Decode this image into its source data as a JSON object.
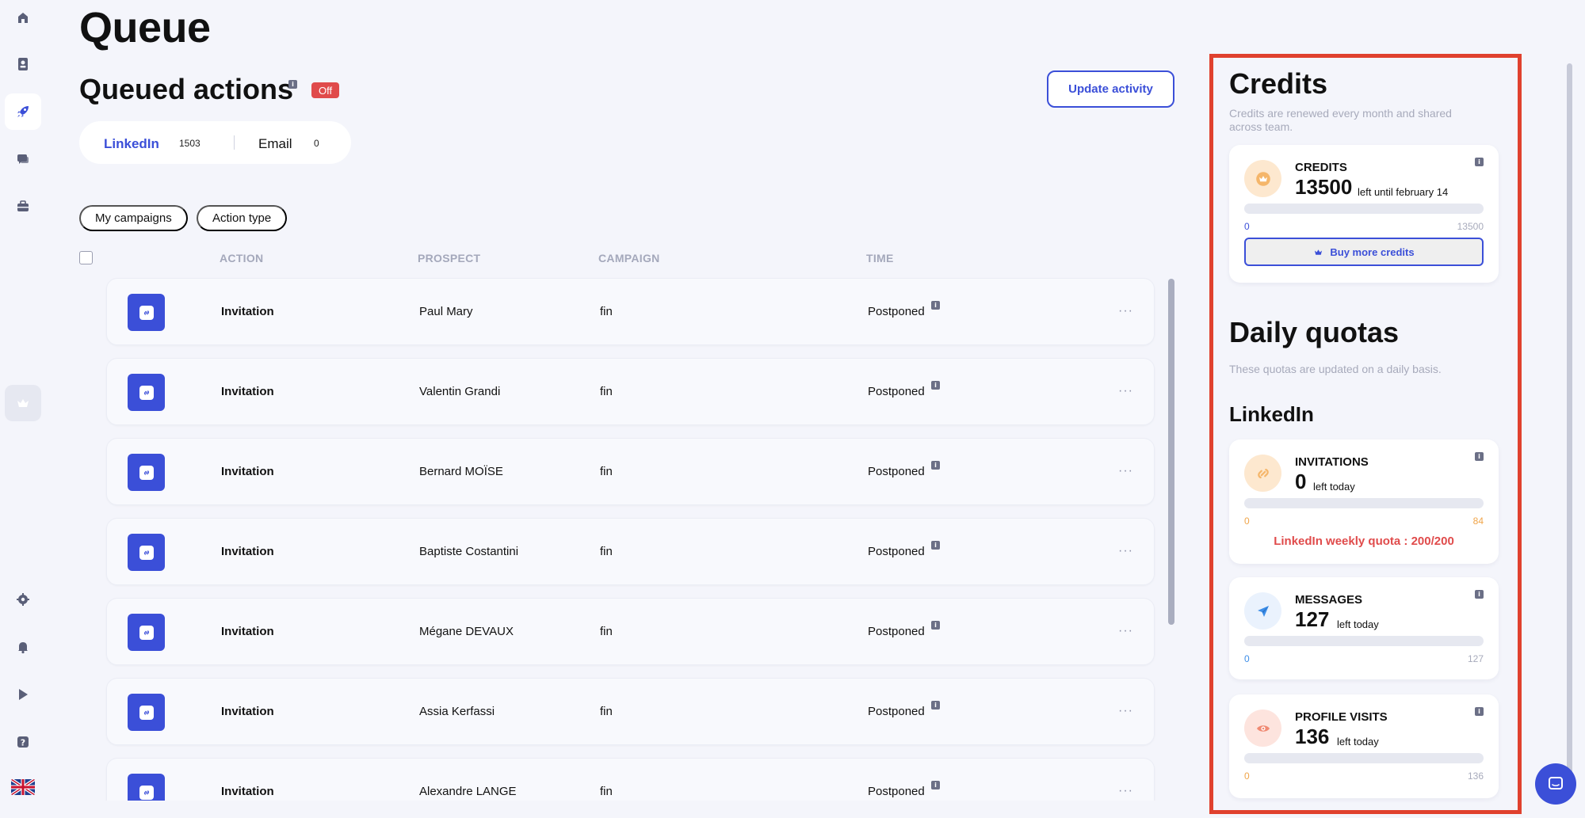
{
  "page": {
    "title": "Queue"
  },
  "queue": {
    "title": "Queued actions",
    "status_badge": "Off",
    "update_button": "Update activity",
    "tabs": [
      {
        "label": "LinkedIn",
        "count": "1503"
      },
      {
        "label": "Email",
        "count": "0"
      }
    ],
    "filters": [
      "My campaigns",
      "Action type"
    ],
    "columns": {
      "action": "ACTION",
      "prospect": "PROSPECT",
      "campaign": "CAMPAIGN",
      "time": "TIME"
    },
    "rows": [
      {
        "action": "Invitation",
        "prospect": "Paul Mary",
        "campaign": "fin",
        "time": "Postponed"
      },
      {
        "action": "Invitation",
        "prospect": "Valentin Grandi",
        "campaign": "fin",
        "time": "Postponed"
      },
      {
        "action": "Invitation",
        "prospect": "Bernard MOÏSE",
        "campaign": "fin",
        "time": "Postponed"
      },
      {
        "action": "Invitation",
        "prospect": "Baptiste Costantini",
        "campaign": "fin",
        "time": "Postponed"
      },
      {
        "action": "Invitation",
        "prospect": "Mégane DEVAUX",
        "campaign": "fin",
        "time": "Postponed"
      },
      {
        "action": "Invitation",
        "prospect": "Assia Kerfassi",
        "campaign": "fin",
        "time": "Postponed"
      },
      {
        "action": "Invitation",
        "prospect": "Alexandre LANGE",
        "campaign": "fin",
        "time": "Postponed"
      }
    ],
    "more_label": "···"
  },
  "credits": {
    "title": "Credits",
    "subtitle": "Credits are renewed every month and shared across team.",
    "card": {
      "label": "CREDITS",
      "value": "13500",
      "suffix": "left until february 14",
      "min": "0",
      "max": "13500",
      "fill_fraction": 0
    },
    "buy_button": "Buy more credits"
  },
  "daily_quotas": {
    "title": "Daily quotas",
    "subtitle": "These quotas are updated on a daily basis.",
    "linkedin_title": "LinkedIn",
    "cards": [
      {
        "label": "INVITATIONS",
        "value": "0",
        "suffix": "left today",
        "min": "0",
        "max": "84",
        "fill_fraction": 0,
        "note": "LinkedIn weekly quota : 200/200"
      },
      {
        "label": "MESSAGES",
        "value": "127",
        "suffix": "left today",
        "min": "0",
        "max": "127",
        "fill_fraction": 0
      },
      {
        "label": "PROFILE VISITS",
        "value": "136",
        "suffix": "left today",
        "min": "0",
        "max": "136",
        "fill_fraction": 0
      }
    ]
  },
  "icons": {
    "sidebar": [
      "home-icon",
      "contacts-icon",
      "rocket-icon",
      "chat-icon",
      "briefcase-icon",
      "crown-icon",
      "settings-icon",
      "bell-icon",
      "play-icon",
      "help-icon",
      "uk-flag-icon"
    ],
    "row": "link-icon",
    "credits": "crown-icon",
    "invitations": "link-icon",
    "messages": "paper-plane-icon",
    "profile_visits": "eye-icon",
    "chat": "chat-bubble-icon"
  },
  "colors": {
    "accent": "#3b4fd8",
    "danger": "#e04b4b",
    "highlight_border": "#e0412e",
    "background": "#f4f5fb"
  },
  "info_glyph": "i"
}
